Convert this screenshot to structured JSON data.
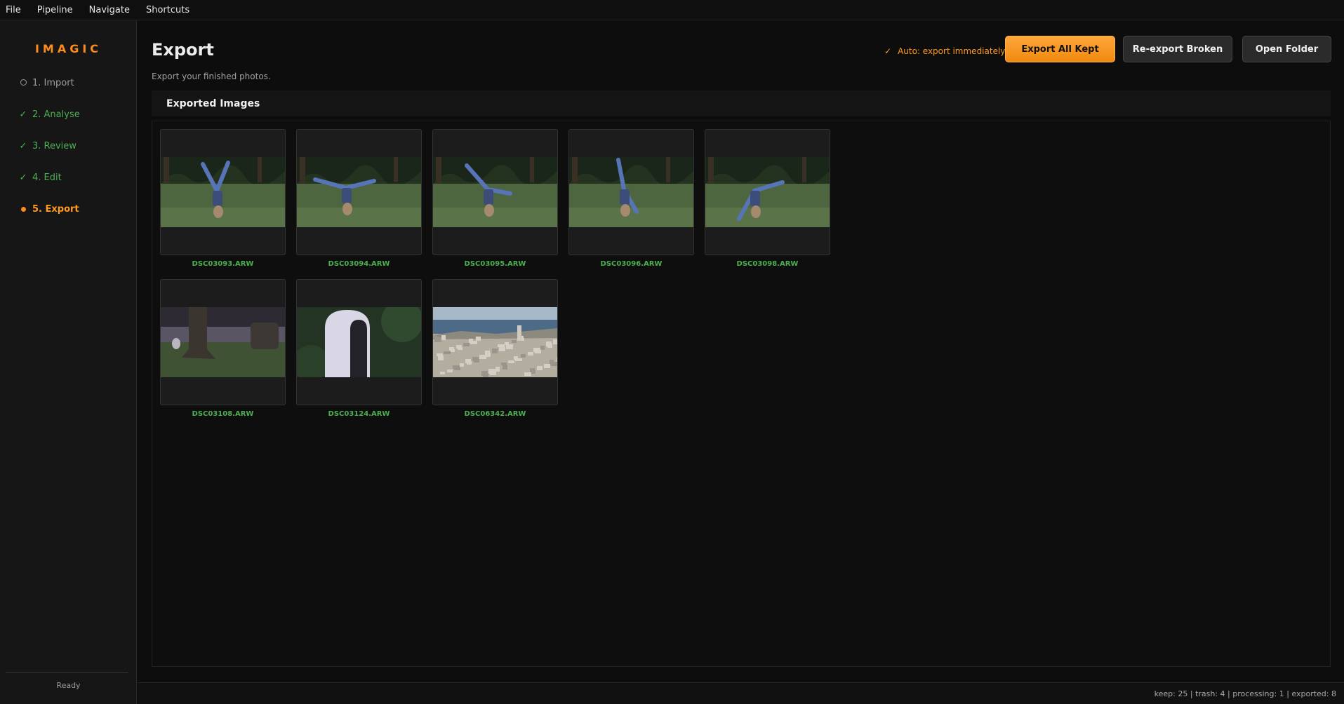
{
  "menu": [
    "File",
    "Pipeline",
    "Navigate",
    "Shortcuts"
  ],
  "sidebar": {
    "logo": "IMAGIC",
    "steps": [
      {
        "label": "1. Import",
        "state": "pending"
      },
      {
        "label": "2. Analyse",
        "state": "done"
      },
      {
        "label": "3. Review",
        "state": "done"
      },
      {
        "label": "4. Edit",
        "state": "done"
      },
      {
        "label": "5. Export",
        "state": "active"
      }
    ],
    "status": "Ready"
  },
  "main": {
    "title": "Export",
    "subtitle": "Export your finished photos.",
    "auto_export": "Auto: export immediately",
    "buttons": {
      "export_all": "Export All Kept",
      "reexport": "Re-export Broken",
      "open_folder": "Open Folder"
    },
    "section_title": "Exported Images",
    "images": [
      {
        "name": "DSC03093.ARW",
        "scene": "cartwheel"
      },
      {
        "name": "DSC03094.ARW",
        "scene": "cartwheel"
      },
      {
        "name": "DSC03095.ARW",
        "scene": "cartwheel"
      },
      {
        "name": "DSC03096.ARW",
        "scene": "cartwheel"
      },
      {
        "name": "DSC03098.ARW",
        "scene": "cartwheel"
      },
      {
        "name": "DSC03108.ARW",
        "scene": "tree"
      },
      {
        "name": "DSC03124.ARW",
        "scene": "sculpture"
      },
      {
        "name": "DSC06342.ARW",
        "scene": "city"
      }
    ]
  },
  "statusbar": {
    "stats": "keep: 25  |  trash: 4  |  processing: 1  |  exported: 8"
  },
  "colors": {
    "accent": "#ff8c1a",
    "done": "#4caf50",
    "pending": "#9e9e9e"
  }
}
